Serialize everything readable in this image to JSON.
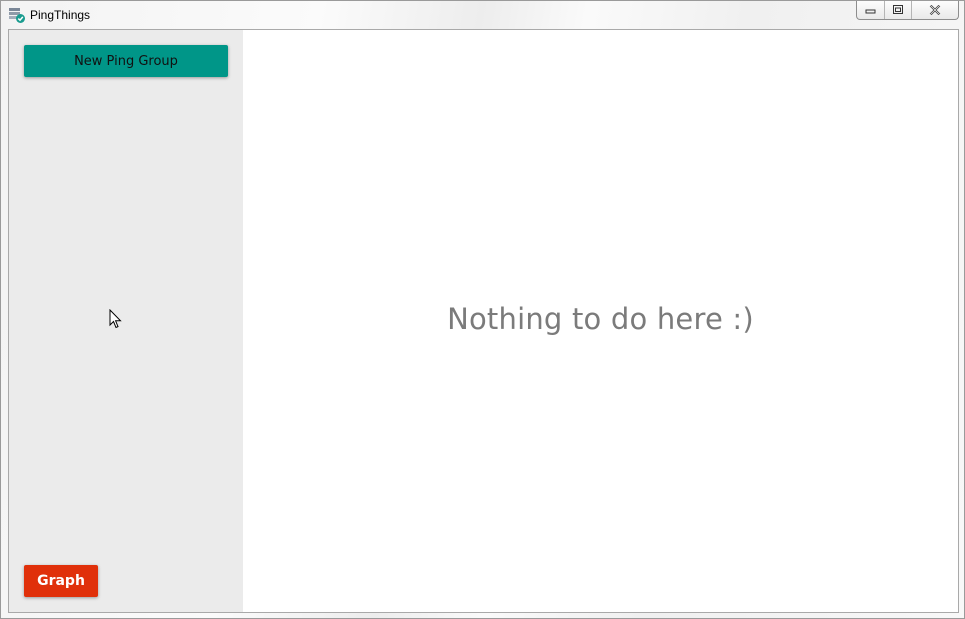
{
  "window": {
    "title": "PingThings",
    "icon": "app-icon"
  },
  "controls": {
    "minimize_icon": "minimize-icon",
    "maximize_icon": "maximize-icon",
    "close_icon": "close-icon"
  },
  "sidebar": {
    "new_group_label": "New Ping Group",
    "graph_label": "Graph"
  },
  "main": {
    "empty_message": "Nothing to do here  :)"
  },
  "colors": {
    "accent_teal": "#009688",
    "accent_red": "#e0300a",
    "sidebar_bg": "#ebebeb",
    "message_text": "#7b7b7b"
  }
}
